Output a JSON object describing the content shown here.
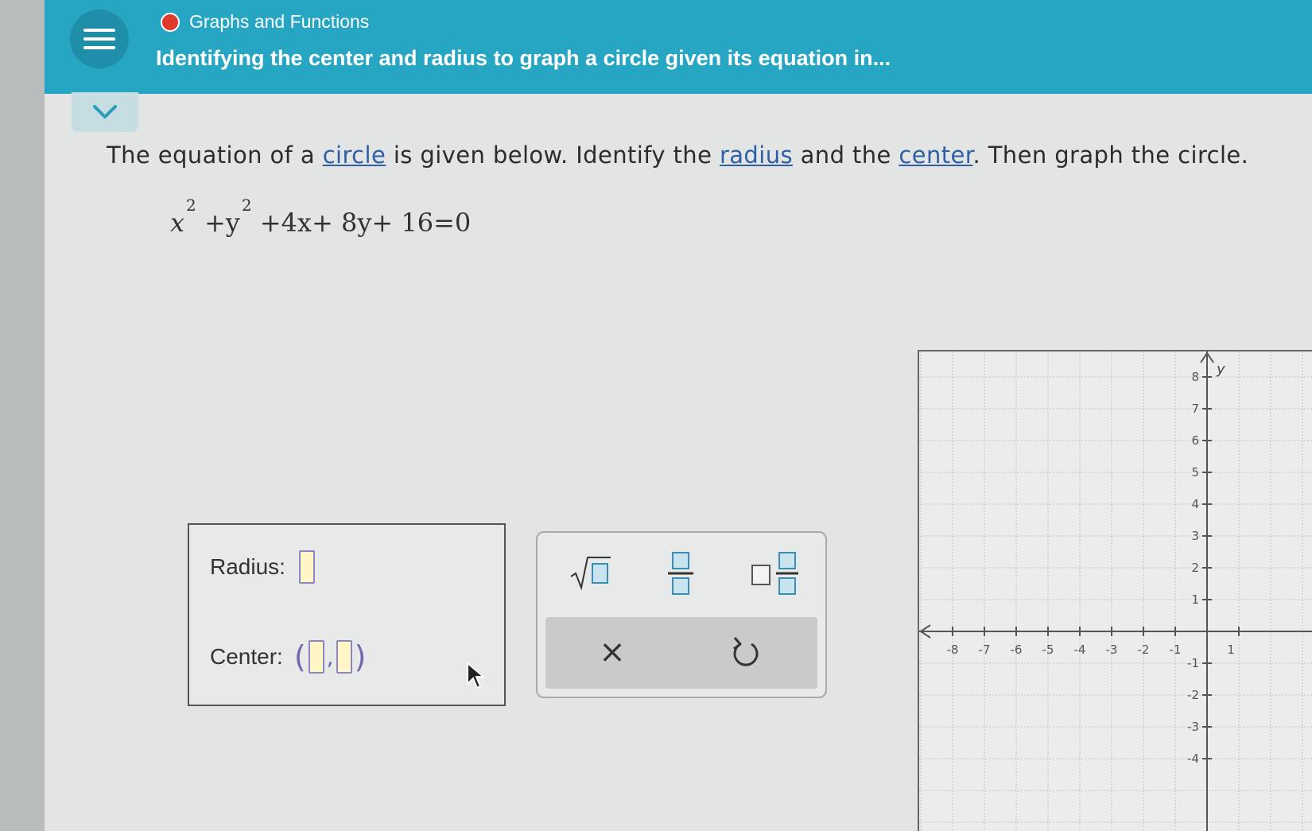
{
  "header": {
    "topic": "Graphs and Functions",
    "lesson_title": "Identifying the center and radius to graph a circle given its equation in..."
  },
  "colors": {
    "header_bg": "#27a6c4",
    "topic_dot": "#e03a2f",
    "link": "#2d5fa8",
    "input_slot": "#fff6c7"
  },
  "question": {
    "part1": "The equation of a ",
    "link_circle": "circle",
    "part2": " is given below. Identify the ",
    "link_radius": "radius",
    "part3": " and the ",
    "link_center": "center",
    "part4": ". Then graph the circle."
  },
  "equation": {
    "x": "x",
    "exp_x": "2",
    "plus_y": " +y",
    "exp_y": "2",
    "rest": " +4x+ 8y+ 16=0"
  },
  "answer": {
    "radius_label": "Radius:",
    "center_label": "Center:",
    "center_open": "(",
    "center_comma": ",",
    "center_close": ")"
  },
  "keypad": {
    "keys": [
      "sqrt-icon",
      "fraction-icon",
      "mixed-number-icon"
    ],
    "clear_symbol": "×",
    "undo_icon": "undo-icon"
  },
  "graph": {
    "y_axis_label": "y",
    "x_ticks": [
      "-8",
      "-7",
      "-6",
      "-5",
      "-4",
      "-3",
      "-2",
      "-1"
    ],
    "y_ticks_pos": [
      "8",
      "7",
      "6",
      "5",
      "4",
      "3",
      "2",
      "1"
    ],
    "y_ticks_neg": [
      "-1",
      "-2",
      "-3",
      "-4"
    ],
    "x_partial_label": "1"
  }
}
